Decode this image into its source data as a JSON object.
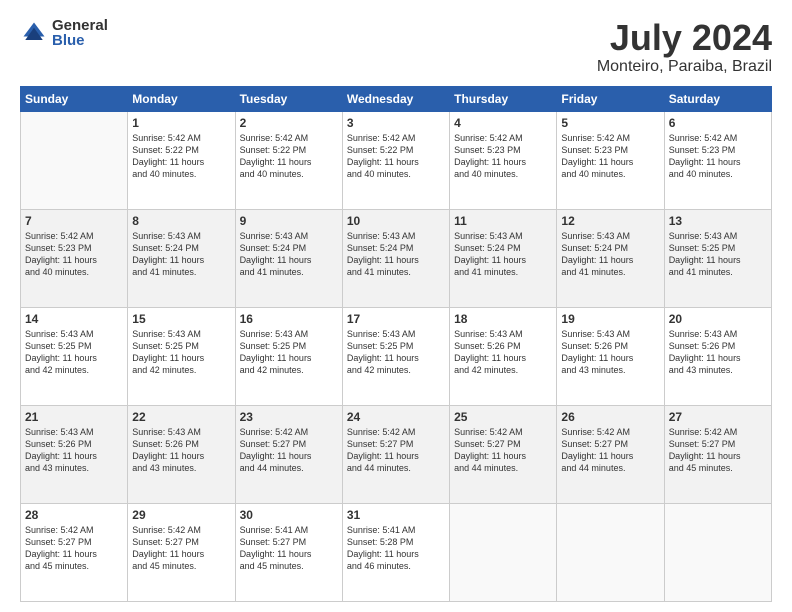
{
  "logo": {
    "general": "General",
    "blue": "Blue"
  },
  "title": "July 2024",
  "location": "Monteiro, Paraiba, Brazil",
  "days_of_week": [
    "Sunday",
    "Monday",
    "Tuesday",
    "Wednesday",
    "Thursday",
    "Friday",
    "Saturday"
  ],
  "weeks": [
    [
      {
        "day": "",
        "info": ""
      },
      {
        "day": "1",
        "info": "Sunrise: 5:42 AM\nSunset: 5:22 PM\nDaylight: 11 hours\nand 40 minutes."
      },
      {
        "day": "2",
        "info": "Sunrise: 5:42 AM\nSunset: 5:22 PM\nDaylight: 11 hours\nand 40 minutes."
      },
      {
        "day": "3",
        "info": "Sunrise: 5:42 AM\nSunset: 5:22 PM\nDaylight: 11 hours\nand 40 minutes."
      },
      {
        "day": "4",
        "info": "Sunrise: 5:42 AM\nSunset: 5:23 PM\nDaylight: 11 hours\nand 40 minutes."
      },
      {
        "day": "5",
        "info": "Sunrise: 5:42 AM\nSunset: 5:23 PM\nDaylight: 11 hours\nand 40 minutes."
      },
      {
        "day": "6",
        "info": "Sunrise: 5:42 AM\nSunset: 5:23 PM\nDaylight: 11 hours\nand 40 minutes."
      }
    ],
    [
      {
        "day": "7",
        "info": "Sunrise: 5:42 AM\nSunset: 5:23 PM\nDaylight: 11 hours\nand 40 minutes."
      },
      {
        "day": "8",
        "info": "Sunrise: 5:43 AM\nSunset: 5:24 PM\nDaylight: 11 hours\nand 41 minutes."
      },
      {
        "day": "9",
        "info": "Sunrise: 5:43 AM\nSunset: 5:24 PM\nDaylight: 11 hours\nand 41 minutes."
      },
      {
        "day": "10",
        "info": "Sunrise: 5:43 AM\nSunset: 5:24 PM\nDaylight: 11 hours\nand 41 minutes."
      },
      {
        "day": "11",
        "info": "Sunrise: 5:43 AM\nSunset: 5:24 PM\nDaylight: 11 hours\nand 41 minutes."
      },
      {
        "day": "12",
        "info": "Sunrise: 5:43 AM\nSunset: 5:24 PM\nDaylight: 11 hours\nand 41 minutes."
      },
      {
        "day": "13",
        "info": "Sunrise: 5:43 AM\nSunset: 5:25 PM\nDaylight: 11 hours\nand 41 minutes."
      }
    ],
    [
      {
        "day": "14",
        "info": "Sunrise: 5:43 AM\nSunset: 5:25 PM\nDaylight: 11 hours\nand 42 minutes."
      },
      {
        "day": "15",
        "info": "Sunrise: 5:43 AM\nSunset: 5:25 PM\nDaylight: 11 hours\nand 42 minutes."
      },
      {
        "day": "16",
        "info": "Sunrise: 5:43 AM\nSunset: 5:25 PM\nDaylight: 11 hours\nand 42 minutes."
      },
      {
        "day": "17",
        "info": "Sunrise: 5:43 AM\nSunset: 5:25 PM\nDaylight: 11 hours\nand 42 minutes."
      },
      {
        "day": "18",
        "info": "Sunrise: 5:43 AM\nSunset: 5:26 PM\nDaylight: 11 hours\nand 42 minutes."
      },
      {
        "day": "19",
        "info": "Sunrise: 5:43 AM\nSunset: 5:26 PM\nDaylight: 11 hours\nand 43 minutes."
      },
      {
        "day": "20",
        "info": "Sunrise: 5:43 AM\nSunset: 5:26 PM\nDaylight: 11 hours\nand 43 minutes."
      }
    ],
    [
      {
        "day": "21",
        "info": "Sunrise: 5:43 AM\nSunset: 5:26 PM\nDaylight: 11 hours\nand 43 minutes."
      },
      {
        "day": "22",
        "info": "Sunrise: 5:43 AM\nSunset: 5:26 PM\nDaylight: 11 hours\nand 43 minutes."
      },
      {
        "day": "23",
        "info": "Sunrise: 5:42 AM\nSunset: 5:27 PM\nDaylight: 11 hours\nand 44 minutes."
      },
      {
        "day": "24",
        "info": "Sunrise: 5:42 AM\nSunset: 5:27 PM\nDaylight: 11 hours\nand 44 minutes."
      },
      {
        "day": "25",
        "info": "Sunrise: 5:42 AM\nSunset: 5:27 PM\nDaylight: 11 hours\nand 44 minutes."
      },
      {
        "day": "26",
        "info": "Sunrise: 5:42 AM\nSunset: 5:27 PM\nDaylight: 11 hours\nand 44 minutes."
      },
      {
        "day": "27",
        "info": "Sunrise: 5:42 AM\nSunset: 5:27 PM\nDaylight: 11 hours\nand 45 minutes."
      }
    ],
    [
      {
        "day": "28",
        "info": "Sunrise: 5:42 AM\nSunset: 5:27 PM\nDaylight: 11 hours\nand 45 minutes."
      },
      {
        "day": "29",
        "info": "Sunrise: 5:42 AM\nSunset: 5:27 PM\nDaylight: 11 hours\nand 45 minutes."
      },
      {
        "day": "30",
        "info": "Sunrise: 5:41 AM\nSunset: 5:27 PM\nDaylight: 11 hours\nand 45 minutes."
      },
      {
        "day": "31",
        "info": "Sunrise: 5:41 AM\nSunset: 5:28 PM\nDaylight: 11 hours\nand 46 minutes."
      },
      {
        "day": "",
        "info": ""
      },
      {
        "day": "",
        "info": ""
      },
      {
        "day": "",
        "info": ""
      }
    ]
  ]
}
